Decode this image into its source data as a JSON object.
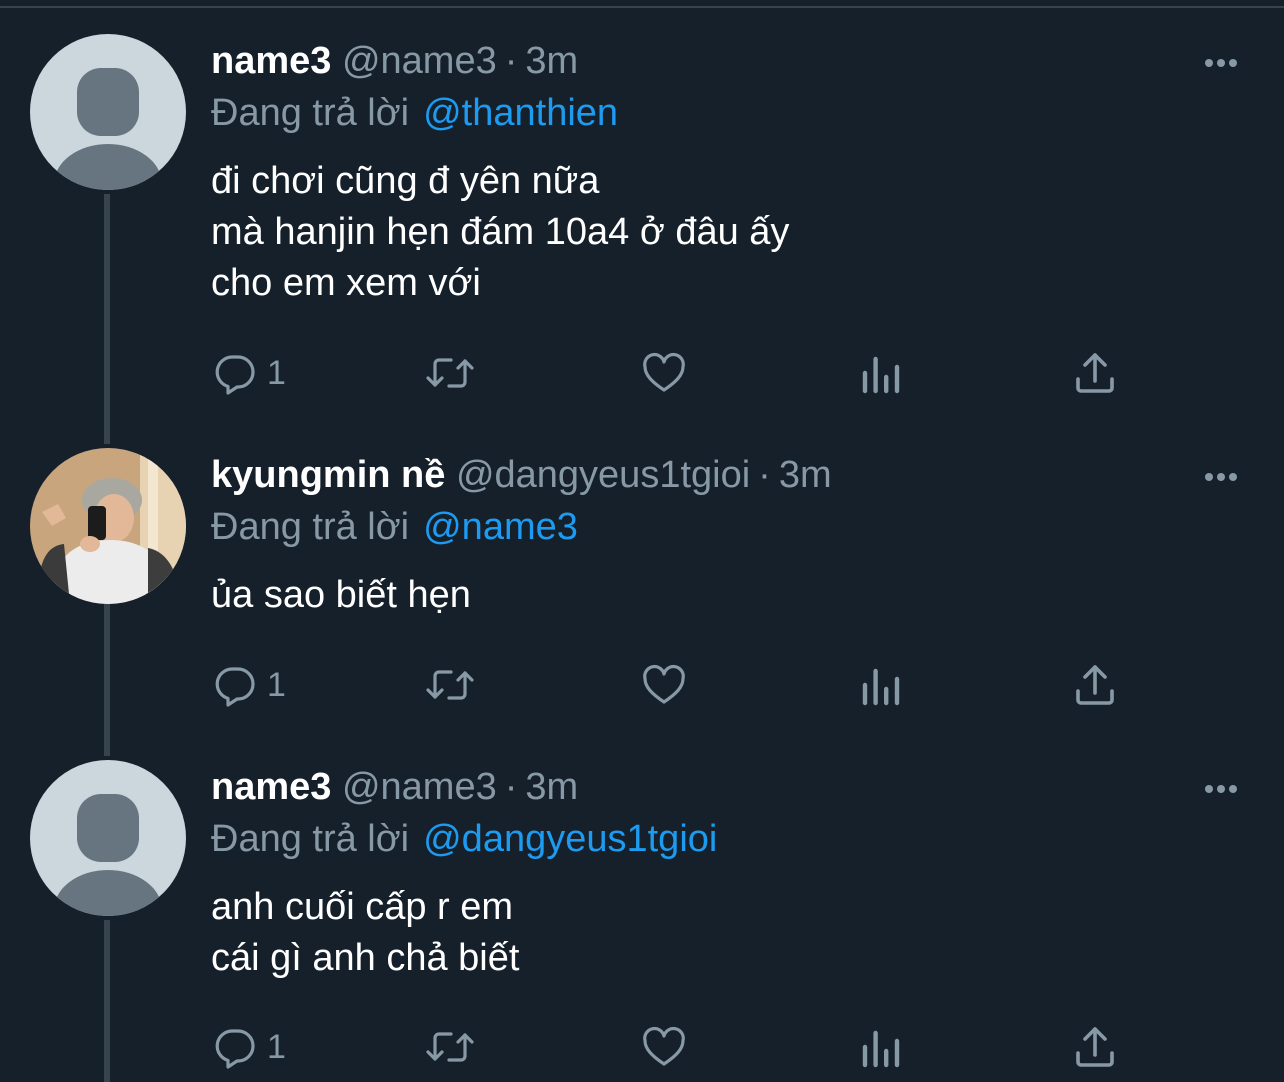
{
  "colors": {
    "background": "#15202b",
    "secondary_text": "#8899a6",
    "accent": "#1d9bf0",
    "divider": "#38444d"
  },
  "tweets": [
    {
      "display_name": "name3",
      "handle": "@name3",
      "separator": "·",
      "time": "3m",
      "reply_label": "Đang trả lời",
      "reply_to": "@thanthien",
      "text": "đi chơi cũng đ yên nữa\nmà hanjin hẹn đám 10a4 ở đâu ấy\ncho em xem với",
      "reply_count": "1",
      "avatar": "default-avatar-icon"
    },
    {
      "display_name": "kyungmin nề",
      "handle": "@dangyeus1tgioi",
      "separator": "·",
      "time": "3m",
      "reply_label": "Đang trả lời",
      "reply_to": "@name3",
      "text": "ủa sao biết hẹn",
      "reply_count": "1",
      "avatar": "photo-avatar"
    },
    {
      "display_name": "name3",
      "handle": "@name3",
      "separator": "·",
      "time": "3m",
      "reply_label": "Đang trả lời",
      "reply_to": "@dangyeus1tgioi",
      "text": "anh cuối cấp r em\ncái gì anh chả biết",
      "reply_count": "1",
      "avatar": "default-avatar-icon"
    }
  ],
  "action_icons": [
    "reply-icon",
    "retweet-icon",
    "like-icon",
    "analytics-icon",
    "share-icon"
  ]
}
